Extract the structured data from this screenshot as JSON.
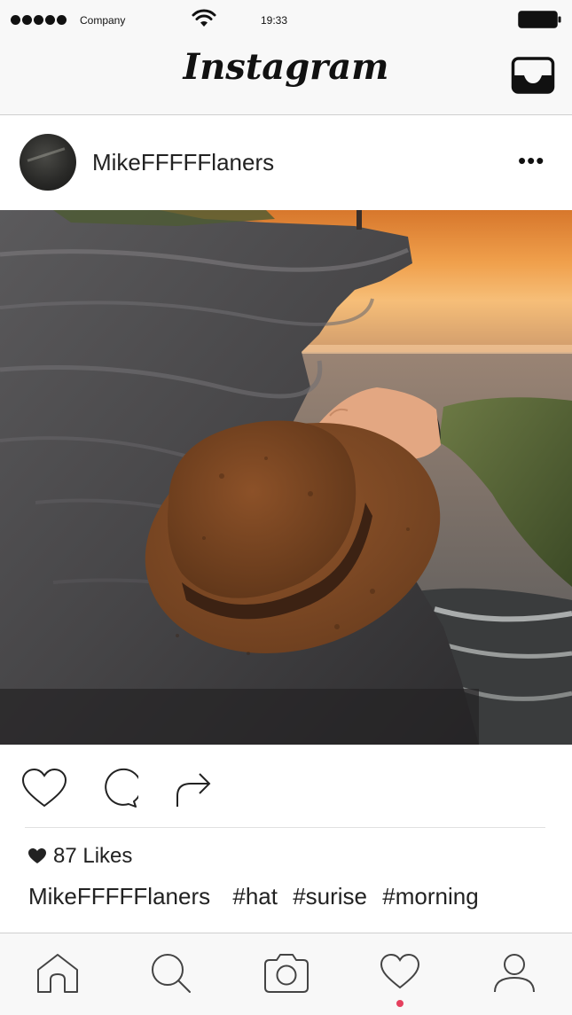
{
  "status_bar": {
    "carrier": "Company",
    "time": "19:33"
  },
  "nav": {
    "app_title": "Instagram",
    "inbox_icon": "inbox-icon"
  },
  "post": {
    "username": "MikeFFFFFlaners",
    "more_label": "•••",
    "photo_icon": "photo-hat-cliff-sunrise",
    "likes_count": "87 Likes",
    "caption_user": "MikeFFFFFlaners",
    "hashtags": [
      "#hat",
      "#surise",
      "#morning"
    ]
  },
  "actions": {
    "like_icon": "heart-icon",
    "comment_icon": "comment-icon",
    "share_icon": "share-icon"
  },
  "tab_bar": {
    "items": [
      "home-icon",
      "search-icon",
      "camera-icon",
      "heart-icon",
      "profile-icon"
    ],
    "active_index": 3,
    "active_color": "#e5405e"
  },
  "colors": {
    "bar_background": "#f8f8f8",
    "text": "#222222",
    "divider": "#cfcfcf"
  }
}
